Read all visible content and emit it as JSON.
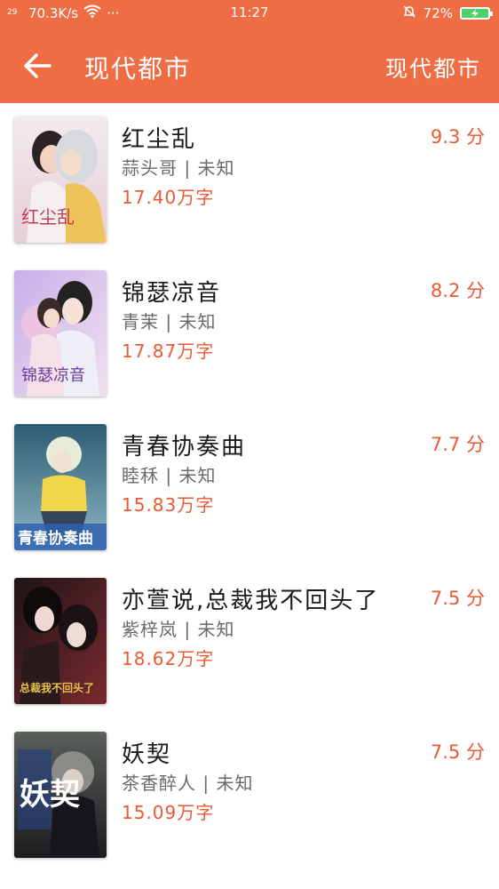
{
  "status": {
    "signal": "29",
    "net_speed": "70.3K/s",
    "more": "···",
    "time": "11:27",
    "battery": "72%",
    "colors": {
      "bar": "#ee6d44",
      "battery_fill": "#4fd06a"
    }
  },
  "header": {
    "back_icon": "arrow-left-icon",
    "title": "现代都市",
    "right_title": "现代都市"
  },
  "books": [
    {
      "title": "红尘乱",
      "author": "蒜头哥",
      "status": "未知",
      "meta": "蒜头哥 | 未知",
      "words": "17.40万字",
      "score": "9.3 分",
      "cover_text": "红尘乱",
      "cover_color": "#ead8e0"
    },
    {
      "title": "锦瑟凉音",
      "author": "青茉",
      "status": "未知",
      "meta": "青茉 | 未知",
      "words": "17.87万字",
      "score": "8.2 分",
      "cover_text": "锦瑟凉音",
      "cover_color": "#d7c4ea"
    },
    {
      "title": "青春协奏曲",
      "author": "睦秝",
      "status": "未知",
      "meta": "睦秝 | 未知",
      "words": "15.83万字",
      "score": "7.7 分",
      "cover_text": "青春协奏曲",
      "cover_color": "#4a7a8f"
    },
    {
      "title": "亦萱说,总裁我不回头了",
      "author": "紫梓岚",
      "status": "未知",
      "meta": "紫梓岚 | 未知",
      "words": "18.62万字",
      "score": "7.5 分",
      "cover_text": "总裁我不回头了",
      "cover_color": "#5b1f24"
    },
    {
      "title": "妖契",
      "author": "茶香醉人",
      "status": "未知",
      "meta": "茶香醉人 | 未知",
      "words": "15.09万字",
      "score": "7.5 分",
      "cover_text": "妖契",
      "cover_color": "#3c3c3c"
    }
  ],
  "accent_color": "#e95a33"
}
